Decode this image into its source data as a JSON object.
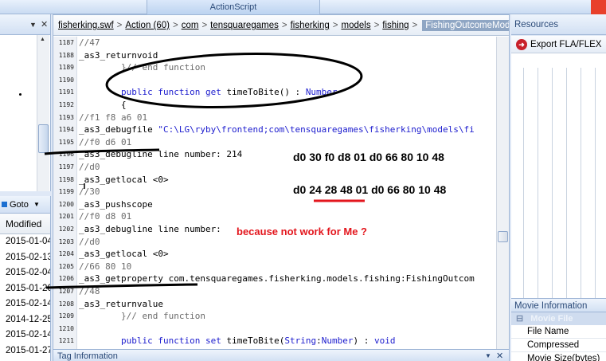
{
  "window": {
    "tab_title": "ActionScript"
  },
  "left_panel": {
    "goto_label": "Goto",
    "column_header": "Modified",
    "rows": [
      "2015-01-04",
      "2015-02-13",
      "2015-02-04",
      "2015-01-26",
      "2015-02-14",
      "2014-12-25",
      "2015-02-14",
      "2015-01-27"
    ]
  },
  "breadcrumb": {
    "items": [
      "fisherking.swf",
      "Action (60)",
      "com",
      "tensquaregames",
      "fisherking",
      "models",
      "fishing"
    ],
    "current": "FishingOutcomeModel"
  },
  "code_lines": [
    {
      "num": "1187",
      "text": "//47",
      "cls": "cmt"
    },
    {
      "num": "1188",
      "text": "_as3_returnvoid",
      "cls": ""
    },
    {
      "num": "1189",
      "text": "        }// end function",
      "cls": "cmt"
    },
    {
      "num": "1190",
      "text": "",
      "cls": ""
    },
    {
      "num": "1191",
      "text": "        public function get timeToBite() : Number",
      "cls": "kwline"
    },
    {
      "num": "1192",
      "text": "        {",
      "cls": ""
    },
    {
      "num": "1193",
      "text": "//f1 f8 a6 01",
      "cls": "cmt"
    },
    {
      "num": "1194",
      "text": "_as3_debugfile \"C:\\LG\\ryby\\frontend;com\\tensquaregames\\fisherking\\models\\fi",
      "cls": "strline"
    },
    {
      "num": "1195",
      "text": "//f0 d6 01",
      "cls": "cmt"
    },
    {
      "num": "1196",
      "text": "_as3_debugline line number: 214",
      "cls": ""
    },
    {
      "num": "1197",
      "text": "//d0",
      "cls": "cmt"
    },
    {
      "num": "1198",
      "text": "_as3_getlocal <0>",
      "cls": ""
    },
    {
      "num": "1199",
      "text": "//30",
      "cls": "cmt"
    },
    {
      "num": "1200",
      "text": "_as3_pushscope",
      "cls": ""
    },
    {
      "num": "1201",
      "text": "//f0 d8 01",
      "cls": "cmt"
    },
    {
      "num": "1202",
      "text": "_as3_debugline line number: ",
      "cls": ""
    },
    {
      "num": "1203",
      "text": "//d0",
      "cls": "cmt"
    },
    {
      "num": "1204",
      "text": "_as3_getlocal <0>",
      "cls": ""
    },
    {
      "num": "1205",
      "text": "//66 80 10",
      "cls": "cmt"
    },
    {
      "num": "1206",
      "text": "_as3_getproperty com.tensquaregames.fisherking.models.fishing:FishingOutcom",
      "cls": ""
    },
    {
      "num": "1207",
      "text": "//48",
      "cls": "cmt"
    },
    {
      "num": "1208",
      "text": "_as3_returnvalue",
      "cls": ""
    },
    {
      "num": "1209",
      "text": "        }// end function",
      "cls": "cmt"
    },
    {
      "num": "1210",
      "text": "",
      "cls": ""
    },
    {
      "num": "1211",
      "text": "        public function set timeToBite(String:Number) : void",
      "cls": "kwline"
    }
  ],
  "annotations": {
    "hex_line_1": "d0 30 f0 d8 01 d0 66 80 10 48",
    "hex_line_2": "d0 24 28 48 01 d0 66 80 10 48",
    "question": "because not work for Me  ?"
  },
  "tag_info": {
    "title": "Tag Information"
  },
  "resources": {
    "title": "Resources",
    "export_label": "Export FLA/FLEX"
  },
  "movie_info": {
    "title": "Movie Information",
    "group": "Movie File",
    "rows": [
      "File Name",
      "Compressed",
      "Movie Size(bytes)"
    ]
  },
  "colors": {
    "accent": "#e8402b",
    "annotation_red": "#e3161d",
    "keyword": "#1c1cce"
  }
}
